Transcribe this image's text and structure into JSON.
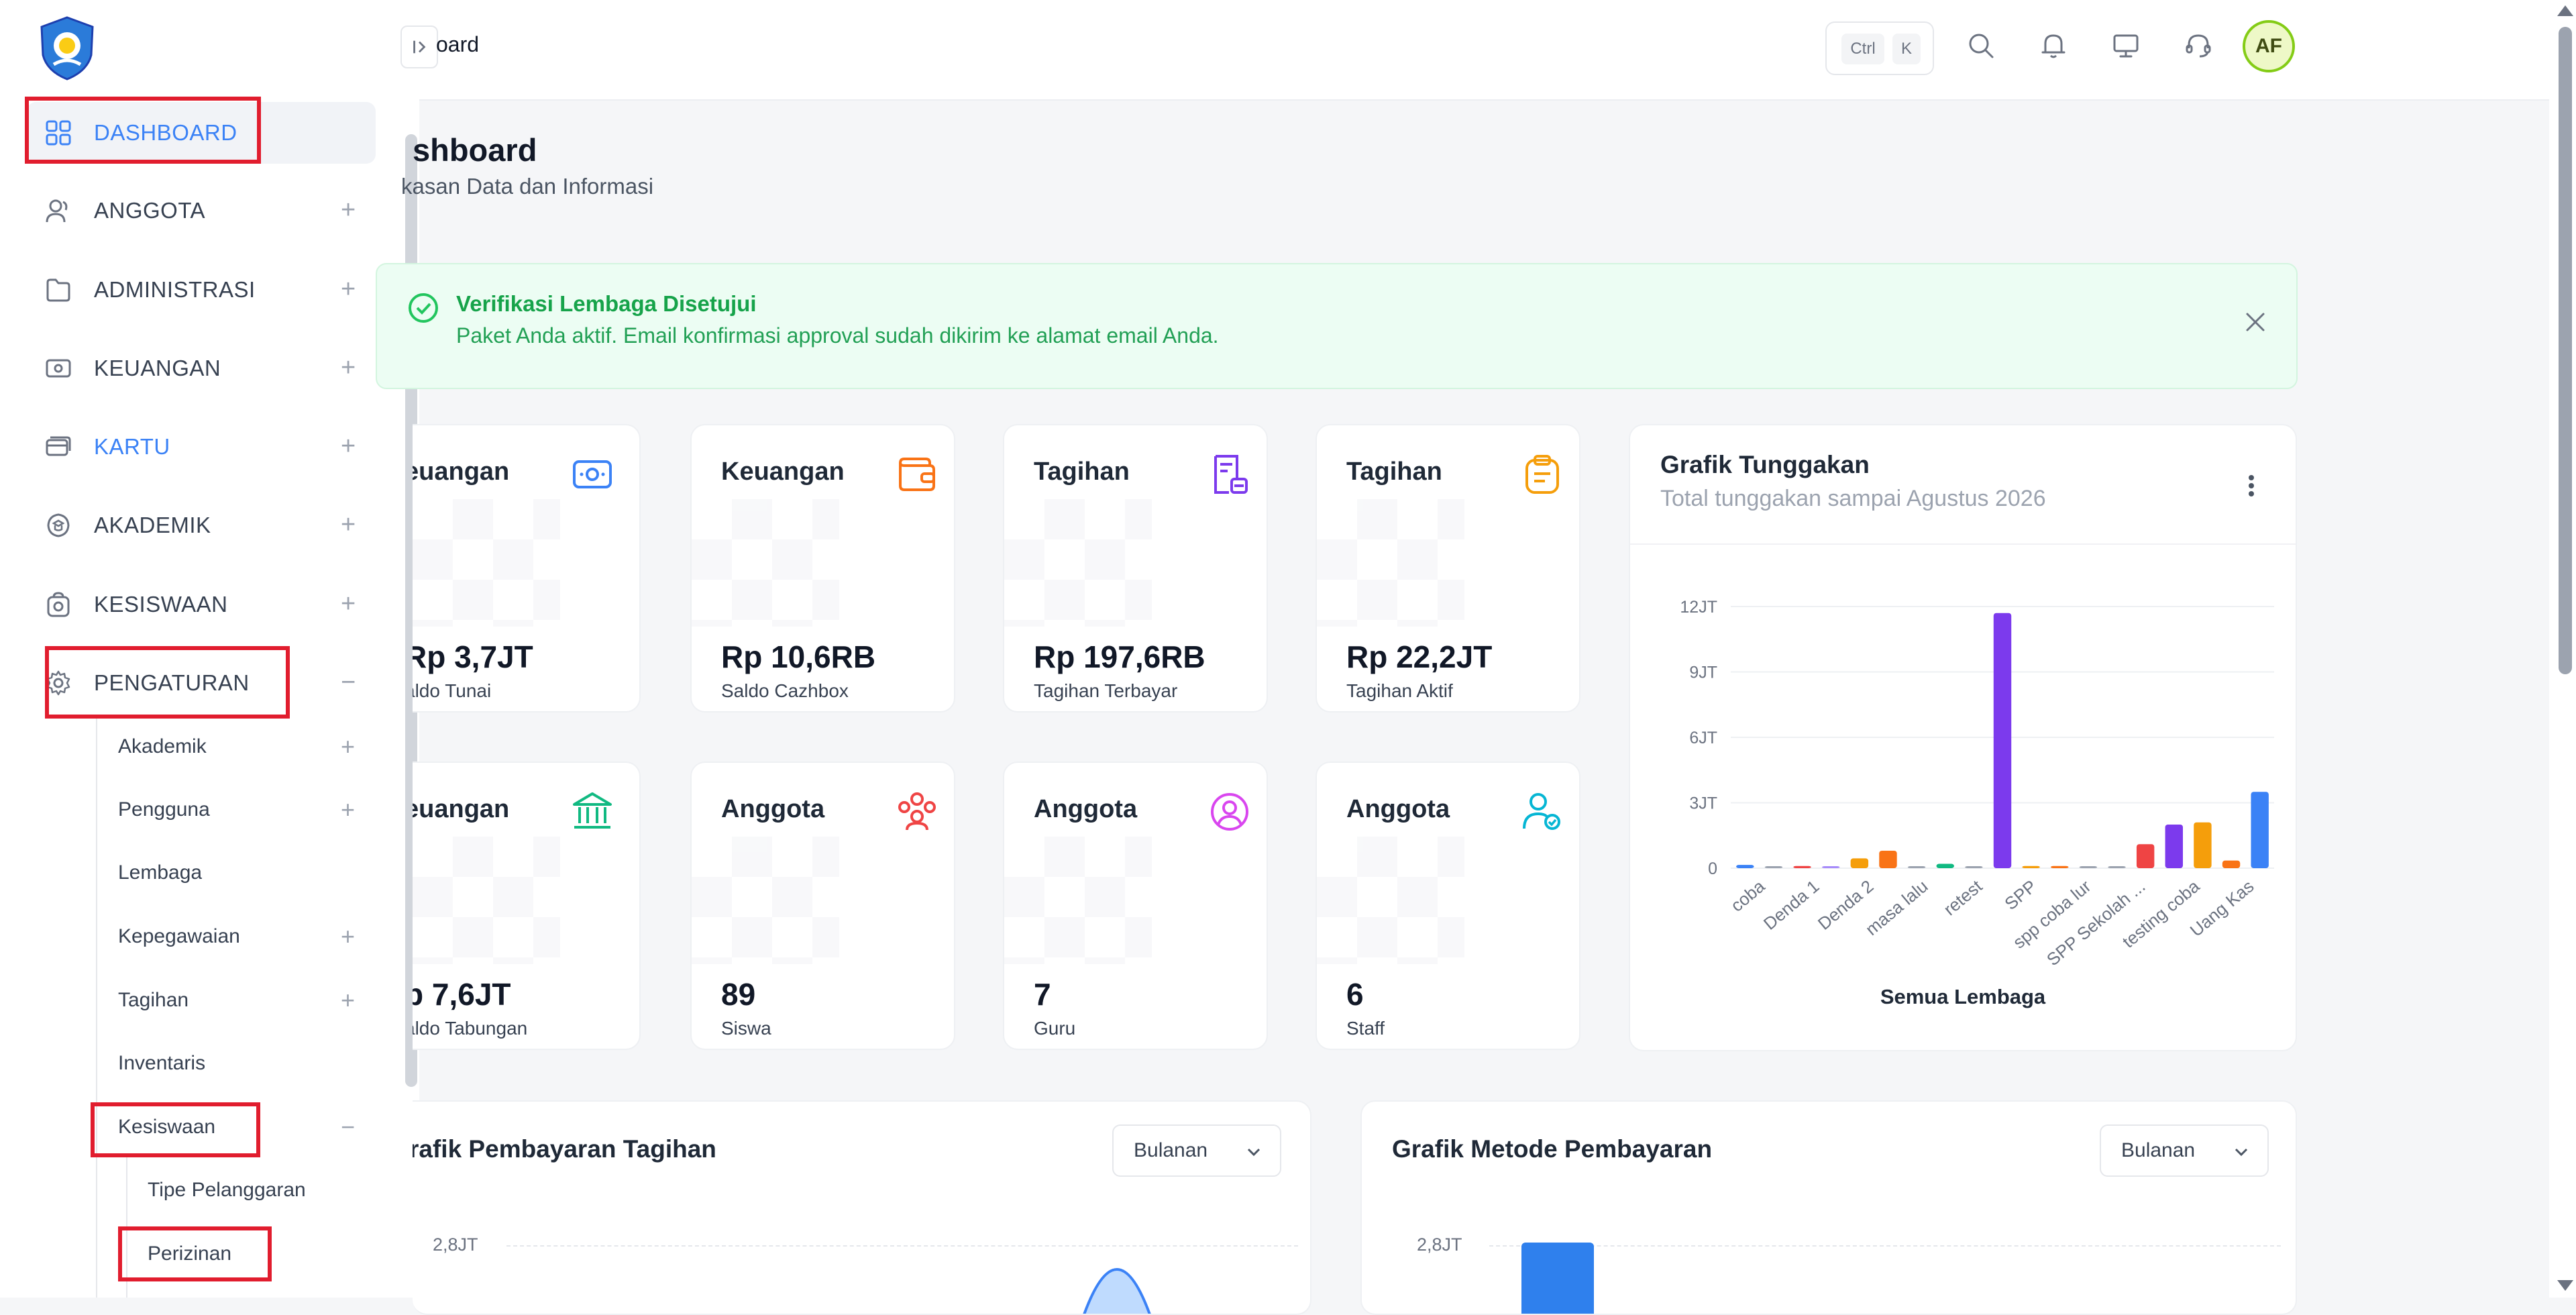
{
  "colors": {
    "accent": "#3b82f6",
    "highlight_box": "#e11d2e",
    "success": "#16a34a",
    "avatar_ring": "#84cc16"
  },
  "sidebar": {
    "logo_icon": "tut-wuri-handayani-logo",
    "items": [
      {
        "label": "DASHBOARD",
        "icon": "grid-icon",
        "expand": ""
      },
      {
        "label": "ANGGOTA",
        "icon": "users-icon",
        "expand": "+"
      },
      {
        "label": "ADMINISTRASI",
        "icon": "folder-icon",
        "expand": "+"
      },
      {
        "label": "KEUANGAN",
        "icon": "money-icon",
        "expand": "+"
      },
      {
        "label": "KARTU",
        "icon": "card-icon",
        "expand": "+"
      },
      {
        "label": "AKADEMIK",
        "icon": "academic-icon",
        "expand": "+"
      },
      {
        "label": "KESISWAAN",
        "icon": "student-icon",
        "expand": "+"
      },
      {
        "label": "PENGATURAN",
        "icon": "gear-icon",
        "expand": "−"
      }
    ],
    "sub_items": [
      {
        "label": "Akademik",
        "expand": "+"
      },
      {
        "label": "Pengguna",
        "expand": "+"
      },
      {
        "label": "Lembaga",
        "expand": ""
      },
      {
        "label": "Kepegawaian",
        "expand": "+"
      },
      {
        "label": "Tagihan",
        "expand": "+"
      },
      {
        "label": "Inventaris",
        "expand": ""
      },
      {
        "label": "Kesiswaan",
        "expand": "−"
      }
    ],
    "sub_sub_items": [
      {
        "label": "Tipe Pelanggaran"
      },
      {
        "label": "Perizinan"
      }
    ]
  },
  "topbar": {
    "breadcrumb": "oard",
    "shortcut_keys": [
      "Ctrl",
      "K"
    ],
    "icons": [
      "search-icon",
      "bell-icon",
      "monitor-icon",
      "headset-icon"
    ],
    "avatar_initials": "AF"
  },
  "page": {
    "title": "shboard",
    "subtitle": "kasan Data dan Informasi"
  },
  "alert": {
    "title": "Verifikasi Lembaga Disetujui",
    "message": "Paket Anda aktif. Email konfirmasi approval sudah dikirim ke alamat email Anda."
  },
  "cards": [
    {
      "title": "euangan",
      "value": "Rp 3,7JT",
      "label": "aldo Tunai",
      "icon": "money-icon",
      "color": "#3b82f6"
    },
    {
      "title": "Keuangan",
      "value": "Rp 10,6RB",
      "label": "Saldo Cazhbox",
      "icon": "wallet-icon",
      "color": "#f97316"
    },
    {
      "title": "Tagihan",
      "value": "Rp 197,6RB",
      "label": "Tagihan Terbayar",
      "icon": "receipt-icon",
      "color": "#7c3aed"
    },
    {
      "title": "Tagihan",
      "value": "Rp 22,2JT",
      "label": "Tagihan Aktif",
      "icon": "clipboard-icon",
      "color": "#f59e0b"
    },
    {
      "title": "euangan",
      "value": "p 7,6JT",
      "label": "aldo Tabungan",
      "icon": "bank-icon",
      "color": "#10b981"
    },
    {
      "title": "Anggota",
      "value": "89",
      "label": "Siswa",
      "icon": "group-icon",
      "color": "#ef4444"
    },
    {
      "title": "Anggota",
      "value": "7",
      "label": "Guru",
      "icon": "user-circle-icon",
      "color": "#d946ef"
    },
    {
      "title": "Anggota",
      "value": "6",
      "label": "Staff",
      "icon": "user-check-icon",
      "color": "#06b6d4"
    }
  ],
  "tunggakan": {
    "title": "Grafik Tunggakan",
    "subtitle": "Total tunggakan sampai Agustus 2026",
    "footer": "Semua Lembaga"
  },
  "chart_data": {
    "type": "bar",
    "title": "Grafik Tunggakan",
    "subtitle": "Total tunggakan sampai Agustus 2026",
    "xlabel": "Semua Lembaga",
    "ylabel": "",
    "ylim": [
      0,
      12000000
    ],
    "yticks": [
      {
        "value": 0,
        "label": "0"
      },
      {
        "value": 3000000,
        "label": "3JT"
      },
      {
        "value": 6000000,
        "label": "6JT"
      },
      {
        "value": 9000000,
        "label": "9JT"
      },
      {
        "value": 12000000,
        "label": "12JT"
      }
    ],
    "grid": true,
    "x_tick_labels": [
      "coba",
      "Denda 1",
      "Denda 2",
      "masa lalu",
      "retest",
      "SPP",
      "spp coba lur",
      "SPP Sekolah ...",
      "testing coba",
      "Uang Kas"
    ],
    "bars": [
      {
        "value": 150000,
        "color": "#3b82f6"
      },
      {
        "value": 50000,
        "color": "#9ca3af"
      },
      {
        "value": 100000,
        "color": "#ef4444"
      },
      {
        "value": 80000,
        "color": "#a78bfa"
      },
      {
        "value": 450000,
        "color": "#f59e0b"
      },
      {
        "value": 800000,
        "color": "#f97316"
      },
      {
        "value": 50000,
        "color": "#9ca3af"
      },
      {
        "value": 200000,
        "color": "#10b981"
      },
      {
        "value": 50000,
        "color": "#9ca3af"
      },
      {
        "value": 11700000,
        "color": "#7c3aed"
      },
      {
        "value": 100000,
        "color": "#f59e0b"
      },
      {
        "value": 100000,
        "color": "#f97316"
      },
      {
        "value": 30000,
        "color": "#9ca3af"
      },
      {
        "value": 30000,
        "color": "#9ca3af"
      },
      {
        "value": 1100000,
        "color": "#ef4444"
      },
      {
        "value": 2000000,
        "color": "#7c3aed"
      },
      {
        "value": 2100000,
        "color": "#f59e0b"
      },
      {
        "value": 350000,
        "color": "#f97316"
      },
      {
        "value": 3500000,
        "color": "#3b82f6"
      }
    ]
  },
  "bottom": {
    "left": {
      "title": "rafik Pembayaran Tagihan",
      "select": "Bulanan",
      "axis_top": "2,8JT"
    },
    "right": {
      "title": "Grafik Metode Pembayaran",
      "select": "Bulanan",
      "axis_top": "2,8JT"
    }
  }
}
